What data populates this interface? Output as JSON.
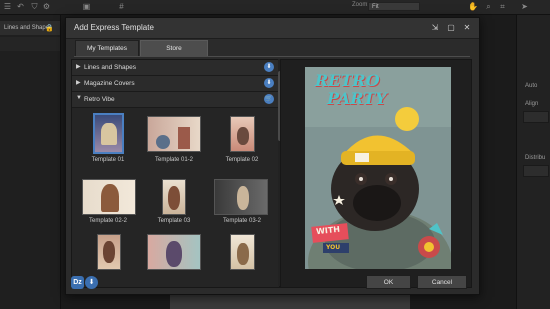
{
  "topbar": {
    "zoom_label": "Zoom:",
    "zoom_value": "Fit"
  },
  "left_panel": {
    "row1": "Lines and Shapes"
  },
  "right_panel": {
    "label1": "Auto",
    "label2": "Align",
    "label3": "Distribu"
  },
  "dialog": {
    "title": "Add Express Template",
    "tabs": [
      {
        "label": "My Templates"
      },
      {
        "label": "Store"
      }
    ],
    "categories": [
      {
        "label": "Lines and Shapes",
        "state": "collapsed"
      },
      {
        "label": "Magazine Covers",
        "state": "collapsed"
      },
      {
        "label": "Retro Vibe",
        "state": "expanded"
      }
    ],
    "templates": [
      {
        "label": "Template 01"
      },
      {
        "label": "Template 01-2"
      },
      {
        "label": "Template 02"
      },
      {
        "label": "Template 02-2"
      },
      {
        "label": "Template 03"
      },
      {
        "label": "Template 03-2"
      }
    ],
    "preview": {
      "headline_line1": "RETRO",
      "headline_line2": "PARTY",
      "sticker_word": "WITH",
      "sticker_word2": "YOU"
    },
    "buttons": {
      "ok": "OK",
      "cancel": "Cancel"
    },
    "footer_logo": "Dz"
  },
  "colors": {
    "accent": "#4a7fc1",
    "dialog_bg": "#2b2b2b",
    "hat": "#f2c230",
    "headline": "#4fc3c8"
  }
}
